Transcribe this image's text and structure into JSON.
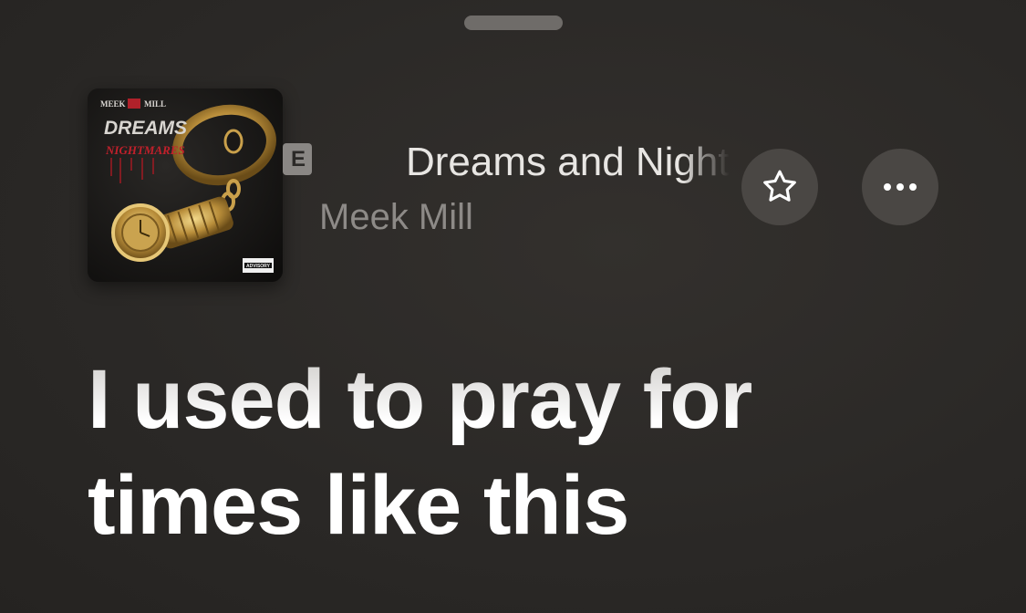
{
  "player": {
    "song_title": "Dreams and Nightmares",
    "artist": "Meek Mill",
    "explicit_badge": "E",
    "album_art": {
      "top_left_text": "MEEK",
      "top_right_text": "MILL",
      "title_text": "DREAMS",
      "subtitle_text": "NIGHTMARES",
      "advisory_text": "ADVISORY"
    }
  },
  "actions": {
    "favorite_icon": "star-outline-icon",
    "more_icon": "ellipsis-icon"
  },
  "lyrics": {
    "current_line": "I used to pray for",
    "next_line": "times like this"
  },
  "colors": {
    "background": "#2b2927",
    "title_text": "#e8e6e3",
    "artist_text": "#8d8a87",
    "button_fill": "#4a4744",
    "lyric_text": "#ffffff"
  }
}
